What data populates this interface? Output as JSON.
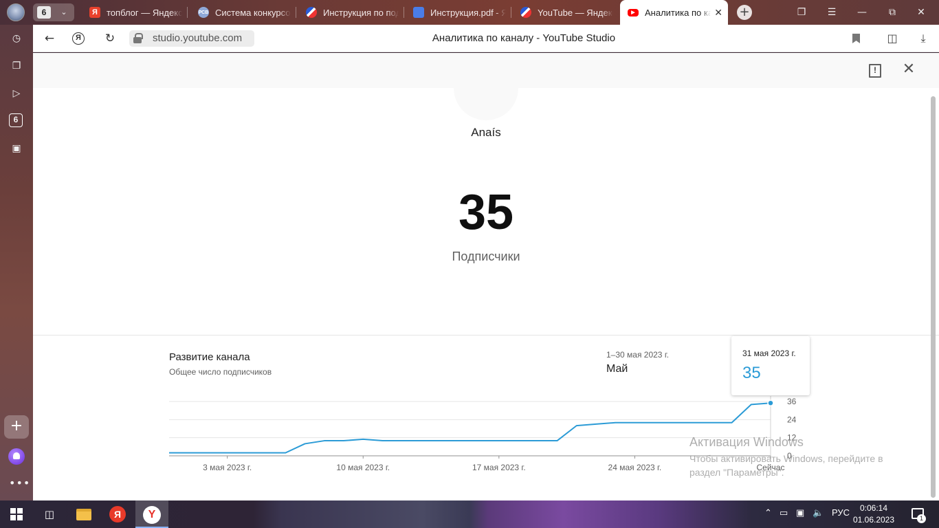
{
  "browser": {
    "tab_count": "6",
    "tabs": [
      {
        "label": "топблог — Яндекс",
        "icon": "yandex-icon"
      },
      {
        "label": "Система конкурсов",
        "icon": "rsv-icon"
      },
      {
        "label": "Инструкция по под",
        "icon": "dart-icon"
      },
      {
        "label": "Инструкция.pdf - Я",
        "icon": "document-icon"
      },
      {
        "label": "YouTube — Яндекс",
        "icon": "dart-icon"
      },
      {
        "label": "Аналитика по кана",
        "icon": "youtube-icon",
        "active": true
      }
    ],
    "url": "studio.youtube.com",
    "page_title": "Аналитика по каналу - YouTube Studio"
  },
  "page": {
    "channel_name": "Anaís",
    "subscriber_count": "35",
    "subscriber_label": "Подписчики",
    "card": {
      "title": "Развитие канала",
      "subtitle": "Общее число подписчиков",
      "period_range": "1–30 мая 2023 г.",
      "period_name": "Май"
    },
    "tooltip": {
      "date": "31 мая 2023 г.",
      "value": "35"
    }
  },
  "chart_data": {
    "type": "line",
    "ylabel": "",
    "xlabel": "",
    "ylim": [
      0,
      36
    ],
    "y_ticks": [
      "36",
      "24",
      "12",
      "0"
    ],
    "x_tick_labels": [
      "3 мая 2023 г.",
      "10 мая 2023 г.",
      "17 мая 2023 г.",
      "24 мая 2023 г.",
      "Сейчас"
    ],
    "x_tick_days": [
      3,
      10,
      17,
      24,
      31
    ],
    "grid": true,
    "color": "#2b9bd6",
    "series": [
      {
        "x": [
          0,
          1,
          2,
          3,
          4,
          5,
          6,
          7,
          8,
          9,
          10,
          11,
          12,
          13,
          14,
          15,
          16,
          17,
          18,
          19,
          20,
          21,
          22,
          23,
          24,
          25,
          26,
          27,
          28,
          29,
          30,
          31
        ],
        "values": [
          2,
          2,
          2,
          2,
          2,
          2,
          2,
          8,
          10,
          10,
          11,
          10,
          10,
          10,
          10,
          10,
          10,
          10,
          10,
          10,
          10,
          20,
          21,
          22,
          22,
          22,
          22,
          22,
          22,
          22,
          34,
          35
        ]
      }
    ]
  },
  "watermark": {
    "title": "Активация Windows",
    "text": "Чтобы активировать Windows, перейдите в раздел \"Параметры\"."
  },
  "taskbar": {
    "language": "РУС",
    "time": "0:06:14",
    "date": "01.06.2023",
    "notifications": "1"
  }
}
